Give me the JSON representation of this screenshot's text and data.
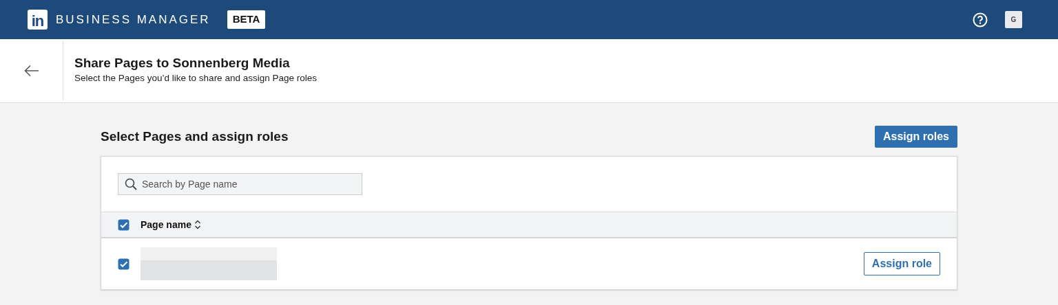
{
  "header": {
    "logo_text": "in",
    "product": "BUSINESS MANAGER",
    "badge": "BETA",
    "avatar": "G"
  },
  "page_header": {
    "title": "Share Pages to Sonnenberg Media",
    "subtitle": "Select the Pages you’d like to share and assign Page roles"
  },
  "section": {
    "title": "Select Pages and assign roles",
    "action": "Assign roles"
  },
  "search": {
    "placeholder": "Search by Page name"
  },
  "table": {
    "select_all": {
      "checked": true
    },
    "column": "Page name",
    "rows": [
      {
        "checked": true,
        "name_redacted": true,
        "action": "Assign role"
      }
    ]
  }
}
